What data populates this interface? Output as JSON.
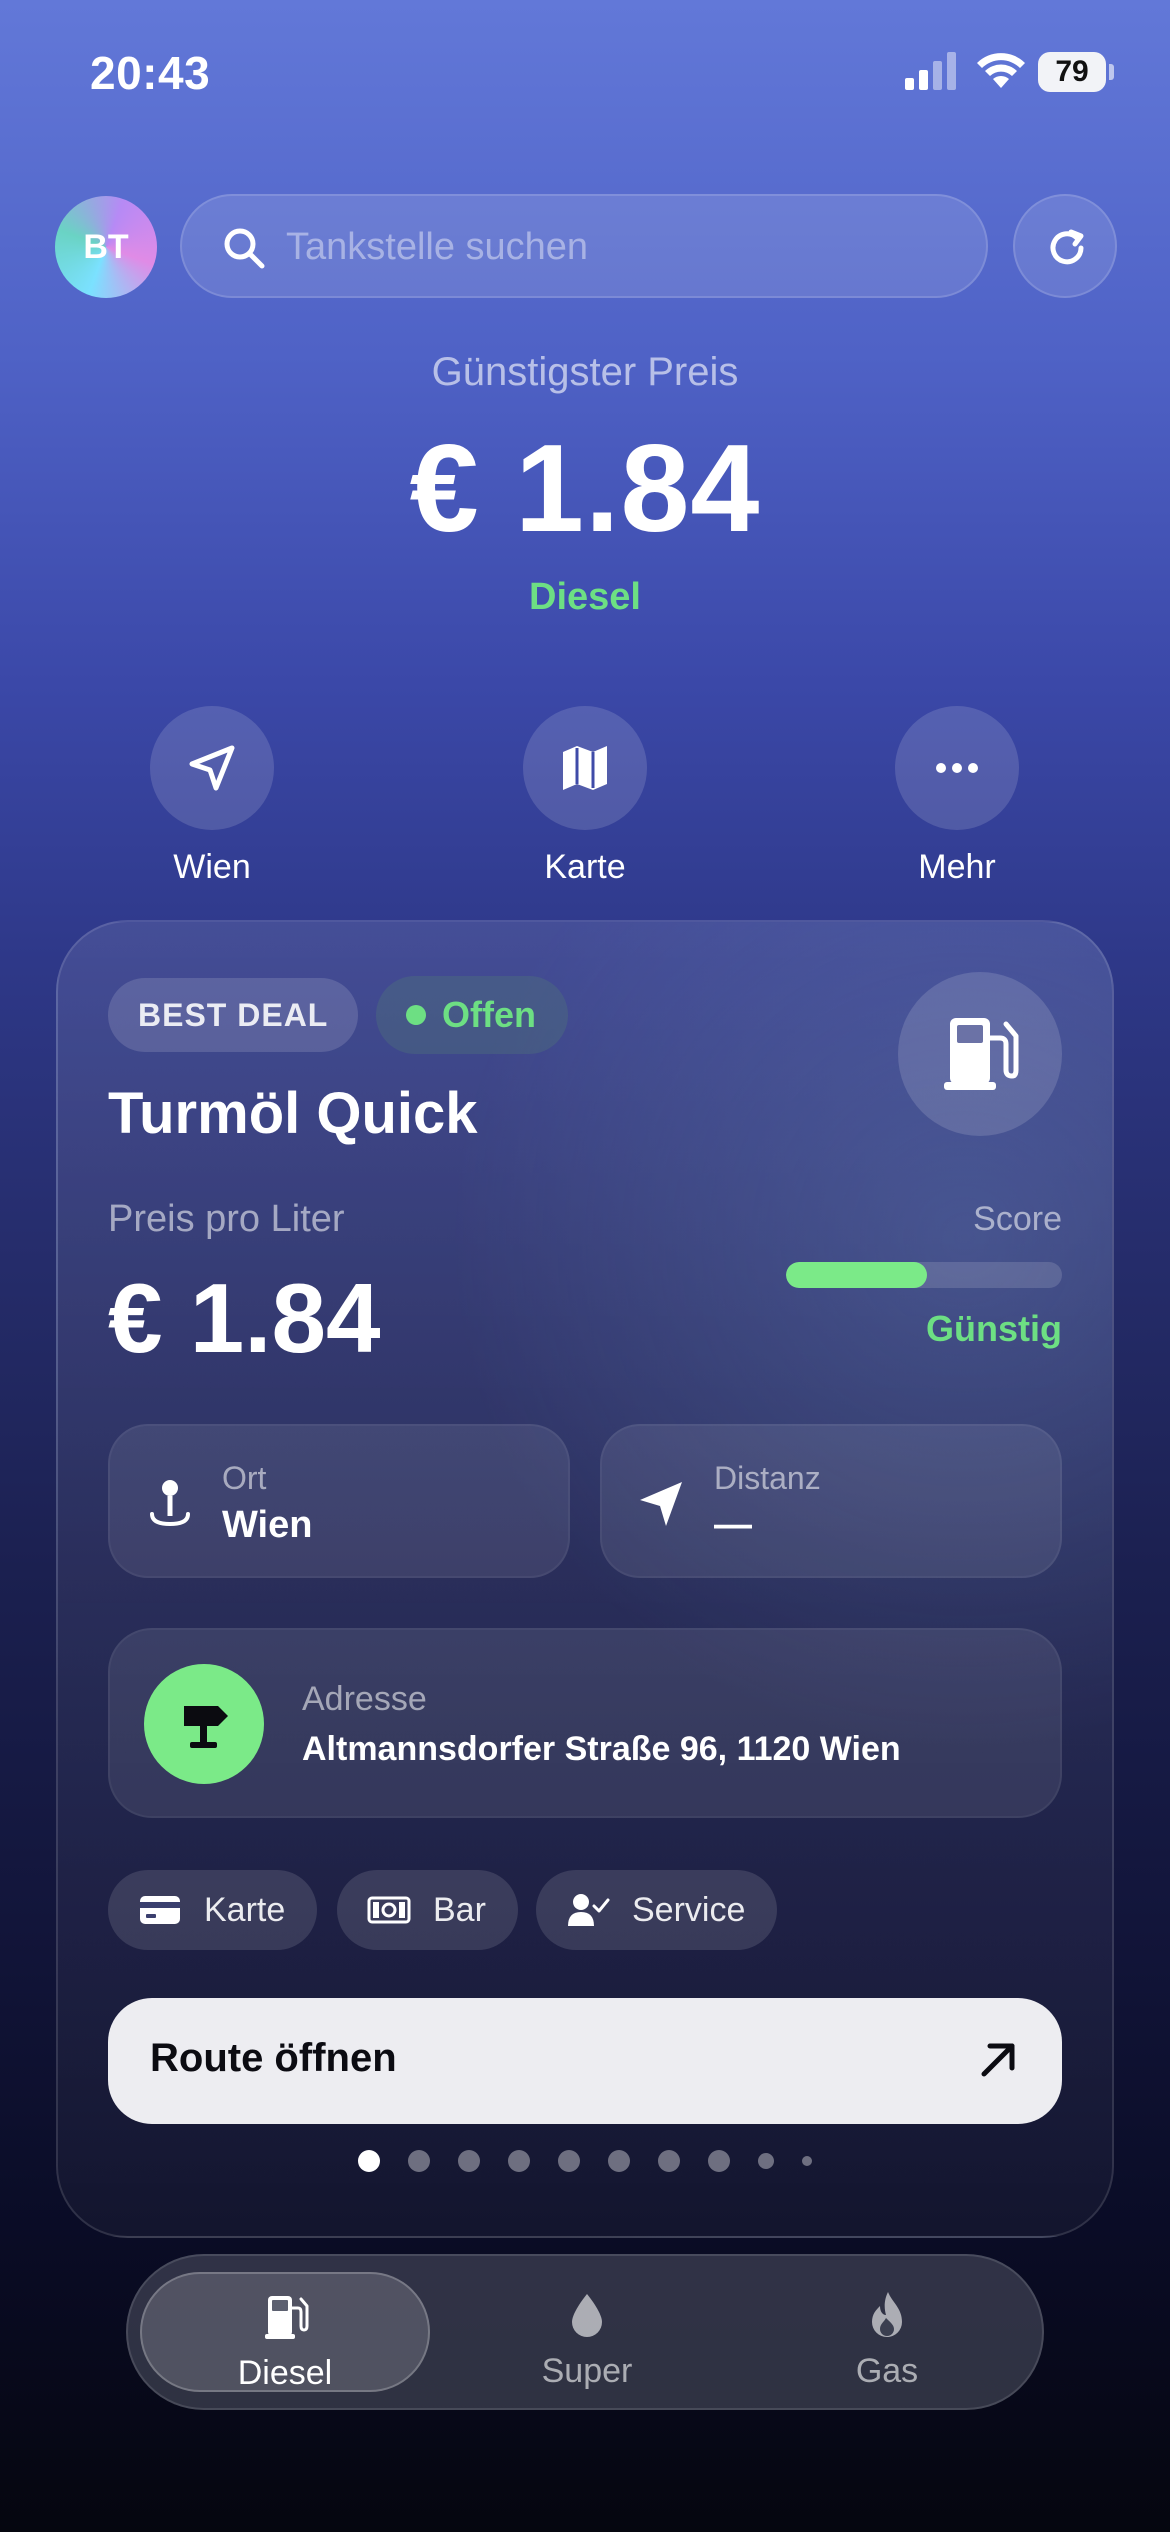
{
  "status_bar": {
    "time": "20:43",
    "battery": "79"
  },
  "header": {
    "avatar_initials": "BT",
    "search_placeholder": "Tankstelle suchen"
  },
  "summary": {
    "label": "Günstigster Preis",
    "price": "€ 1.84",
    "fuel": "Diesel"
  },
  "quick_actions": [
    {
      "label": "Wien",
      "icon": "location-arrow-icon"
    },
    {
      "label": "Karte",
      "icon": "map-icon"
    },
    {
      "label": "Mehr",
      "icon": "more-dots-icon"
    }
  ],
  "card": {
    "badge": "BEST DEAL",
    "status": "Offen",
    "station_name": "Turmöl Quick",
    "price_label": "Preis pro Liter",
    "price": "€ 1.84",
    "score_label": "Score",
    "score_fraction": 0.51,
    "score_text": "Günstig",
    "location": {
      "label": "Ort",
      "value": "Wien"
    },
    "distance": {
      "label": "Distanz",
      "value": "—"
    },
    "address": {
      "label": "Adresse",
      "value": "Altmannsdorfer Straße 96, 1120 Wien"
    },
    "payment_chips": [
      {
        "label": "Karte",
        "icon": "credit-card-icon"
      },
      {
        "label": "Bar",
        "icon": "cash-icon"
      },
      {
        "label": "Service",
        "icon": "person-check-icon"
      }
    ],
    "route_button": "Route öffnen",
    "page_count": 10,
    "active_page": 0
  },
  "tabs": [
    {
      "label": "Diesel",
      "icon": "fuel-pump-icon",
      "active": true
    },
    {
      "label": "Super",
      "icon": "drop-icon",
      "active": false
    },
    {
      "label": "Gas",
      "icon": "flame-icon",
      "active": false
    }
  ],
  "colors": {
    "accent_green": "#6ddf83",
    "score_fill": "#7bea88"
  }
}
